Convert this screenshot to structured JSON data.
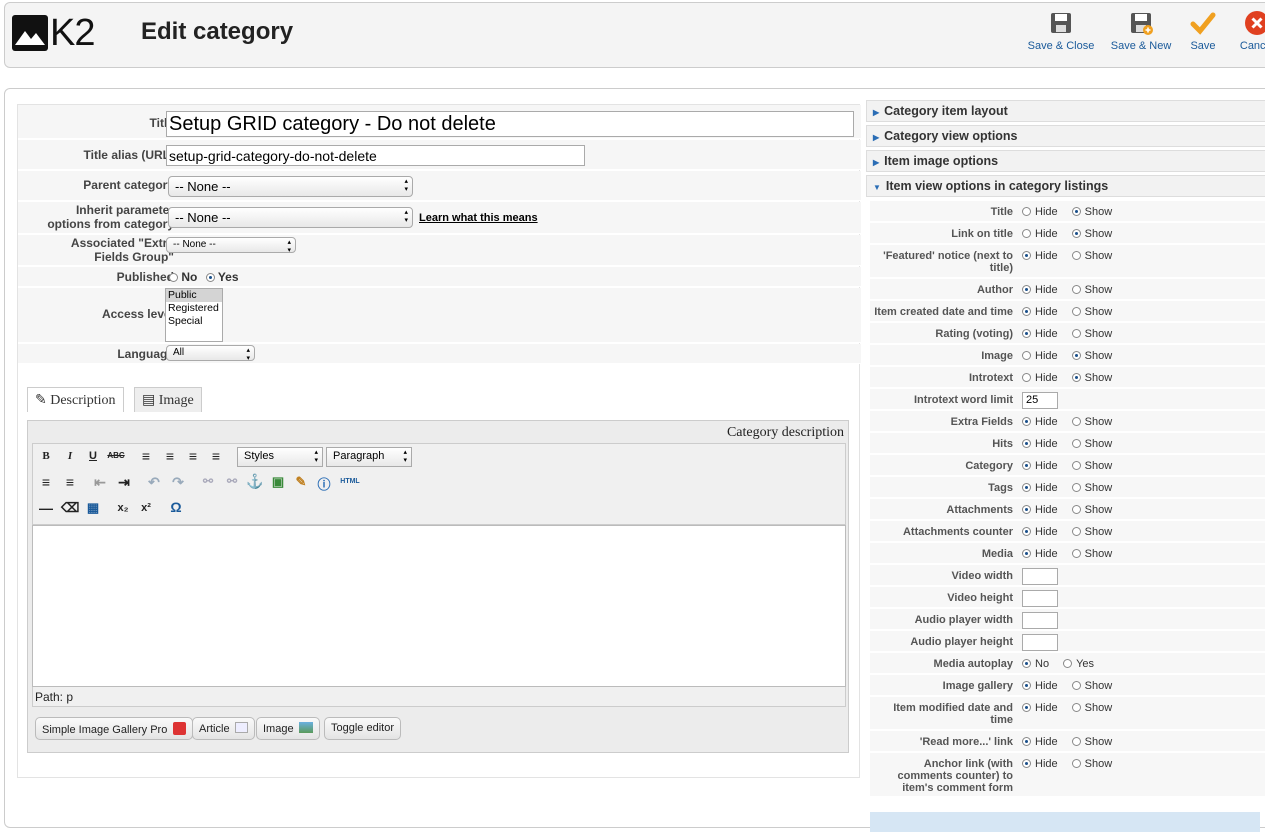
{
  "header": {
    "logo_text": "K2",
    "title": "Edit category",
    "buttons": {
      "save_close": "Save & Close",
      "save_new": "Save & New",
      "save": "Save",
      "cancel": "Cancel"
    },
    "colors": {
      "save_icon": "#f0a020",
      "cancel_icon": "#e04020",
      "link": "#1a5a9a"
    }
  },
  "form": {
    "title_label": "Title",
    "title_value": "Setup GRID category - Do not delete",
    "alias_label": "Title alias (URL)",
    "alias_value": "setup-grid-category-do-not-delete",
    "parent_label": "Parent category",
    "parent_value": "-- None --",
    "inherit_label_1": "Inherit parameter",
    "inherit_label_2": "options from category",
    "inherit_value": "-- None --",
    "inherit_link": "Learn what this means",
    "extra_label_1": "Associated \"Extra",
    "extra_label_2": "Fields Group\"",
    "extra_value": "-- None --",
    "published_label": "Published",
    "published_no": "No",
    "published_yes": "Yes",
    "access_label": "Access level",
    "access_options": [
      "Public",
      "Registered",
      "Special"
    ],
    "language_label": "Language",
    "language_value": "All"
  },
  "tabs": {
    "description": "Description",
    "image": "Image"
  },
  "editor": {
    "caption": "Category description",
    "styles": "Styles",
    "paragraph": "Paragraph",
    "path": "Path: p",
    "html_label": "HTML",
    "plugin_buttons": [
      "Simple Image Gallery Pro",
      "Article",
      "Image",
      "Toggle editor"
    ]
  },
  "right": {
    "accordions": [
      "Category item layout",
      "Category view options",
      "Item image options",
      "Item view options in category listings"
    ],
    "hide": "Hide",
    "show": "Show",
    "no": "No",
    "yes": "Yes",
    "rows": [
      {
        "label": "Title",
        "value": "show"
      },
      {
        "label": "Link on title",
        "value": "show"
      },
      {
        "label": "'Featured' notice (next to title)",
        "value": "hide"
      },
      {
        "label": "Author",
        "value": "hide"
      },
      {
        "label": "Item created date and time",
        "value": "hide"
      },
      {
        "label": "Rating (voting)",
        "value": "hide"
      },
      {
        "label": "Image",
        "value": "show"
      },
      {
        "label": "Introtext",
        "value": "show"
      },
      {
        "label": "Introtext word limit",
        "input": "25"
      },
      {
        "label": "Extra Fields",
        "value": "hide"
      },
      {
        "label": "Hits",
        "value": "hide"
      },
      {
        "label": "Category",
        "value": "hide"
      },
      {
        "label": "Tags",
        "value": "hide"
      },
      {
        "label": "Attachments",
        "value": "hide"
      },
      {
        "label": "Attachments counter",
        "value": "hide"
      },
      {
        "label": "Media",
        "value": "hide"
      },
      {
        "label": "Video width",
        "input": ""
      },
      {
        "label": "Video height",
        "input": ""
      },
      {
        "label": "Audio player width",
        "input": ""
      },
      {
        "label": "Audio player height",
        "input": ""
      },
      {
        "label": "Media autoplay",
        "value": "no"
      },
      {
        "label": "Image gallery",
        "value": "hide"
      },
      {
        "label": "Item modified date and time",
        "value": "hide"
      },
      {
        "label": "'Read more...' link",
        "value": "hide"
      },
      {
        "label": "Anchor link (with comments counter) to item's comment form",
        "value": "hide"
      }
    ]
  }
}
